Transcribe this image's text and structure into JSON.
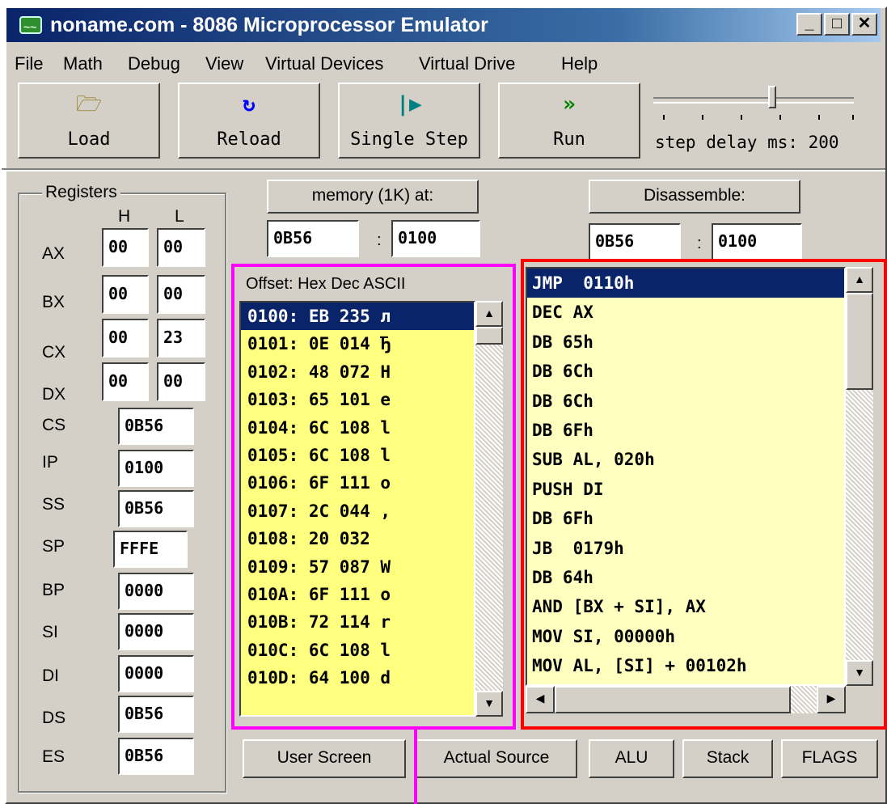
{
  "window": {
    "title": "noname.com - 8086 Microprocessor Emulator"
  },
  "menu": [
    "File",
    "Math",
    "Debug",
    "View",
    "Virtual Devices",
    "Virtual Drive",
    "Help"
  ],
  "toolbar": {
    "load": "Load",
    "reload": "Reload",
    "single_step": "Single Step",
    "run": "Run",
    "step_delay": "step delay ms: 200",
    "step_delay_ms": 200
  },
  "registers": {
    "title": "Registers",
    "h": "H",
    "l": "L",
    "ax": {
      "label": "AX",
      "h": "00",
      "l": "00"
    },
    "bx": {
      "label": "BX",
      "h": "00",
      "l": "00"
    },
    "cx": {
      "label": "CX",
      "h": "00",
      "l": "23"
    },
    "dx": {
      "label": "DX",
      "h": "00",
      "l": "00"
    },
    "cs": {
      "label": "CS",
      "value": "0B56"
    },
    "ip": {
      "label": "IP",
      "value": "0100"
    },
    "ss": {
      "label": "SS",
      "value": "0B56"
    },
    "sp": {
      "label": "SP",
      "value": "FFFE"
    },
    "bp": {
      "label": "BP",
      "value": "0000"
    },
    "si": {
      "label": "SI",
      "value": "0000"
    },
    "di": {
      "label": "DI",
      "value": "0000"
    },
    "ds": {
      "label": "DS",
      "value": "0B56"
    },
    "es": {
      "label": "ES",
      "value": "0B56"
    }
  },
  "memory": {
    "button": "memory (1K) at:",
    "segment": "0B56",
    "offset": "0100",
    "colon": ":",
    "header": "Offset:    Hex  Dec ASCII",
    "rows": [
      "0100: EB 235 л",
      "0101: 0E 014 Ђ",
      "0102: 48 072 H",
      "0103: 65 101 e",
      "0104: 6C 108 l",
      "0105: 6C 108 l",
      "0106: 6F 111 o",
      "0107: 2C 044 ,",
      "0108: 20 032  ",
      "0109: 57 087 W",
      "010A: 6F 111 o",
      "010B: 72 114 r",
      "010C: 6C 108 l",
      "010D: 64 100 d"
    ]
  },
  "disassemble": {
    "button": "Disassemble:",
    "segment": "0B56",
    "offset": "0100",
    "colon": ":",
    "rows": [
      "JMP  0110h",
      "DEC AX",
      "DB 65h",
      "DB 6Ch",
      "DB 6Ch",
      "DB 6Fh",
      "SUB AL, 020h",
      "PUSH DI",
      "DB 6Fh",
      "JB  0179h",
      "DB 64h",
      "AND [BX + SI], AX",
      "MOV SI, 00000h",
      "MOV AL, [SI] + 00102h"
    ]
  },
  "bottom_buttons": {
    "user_screen": "User Screen",
    "actual_source": "Actual Source",
    "alu": "ALU",
    "stack": "Stack",
    "flags": "FLAGS"
  },
  "colors": {
    "title_bar": "#0a246a",
    "memory_highlight": "#ff00ff",
    "disassemble_highlight": "#ff0000",
    "memory_bg": "#ffff80",
    "disassemble_bg": "#ffffc0"
  }
}
